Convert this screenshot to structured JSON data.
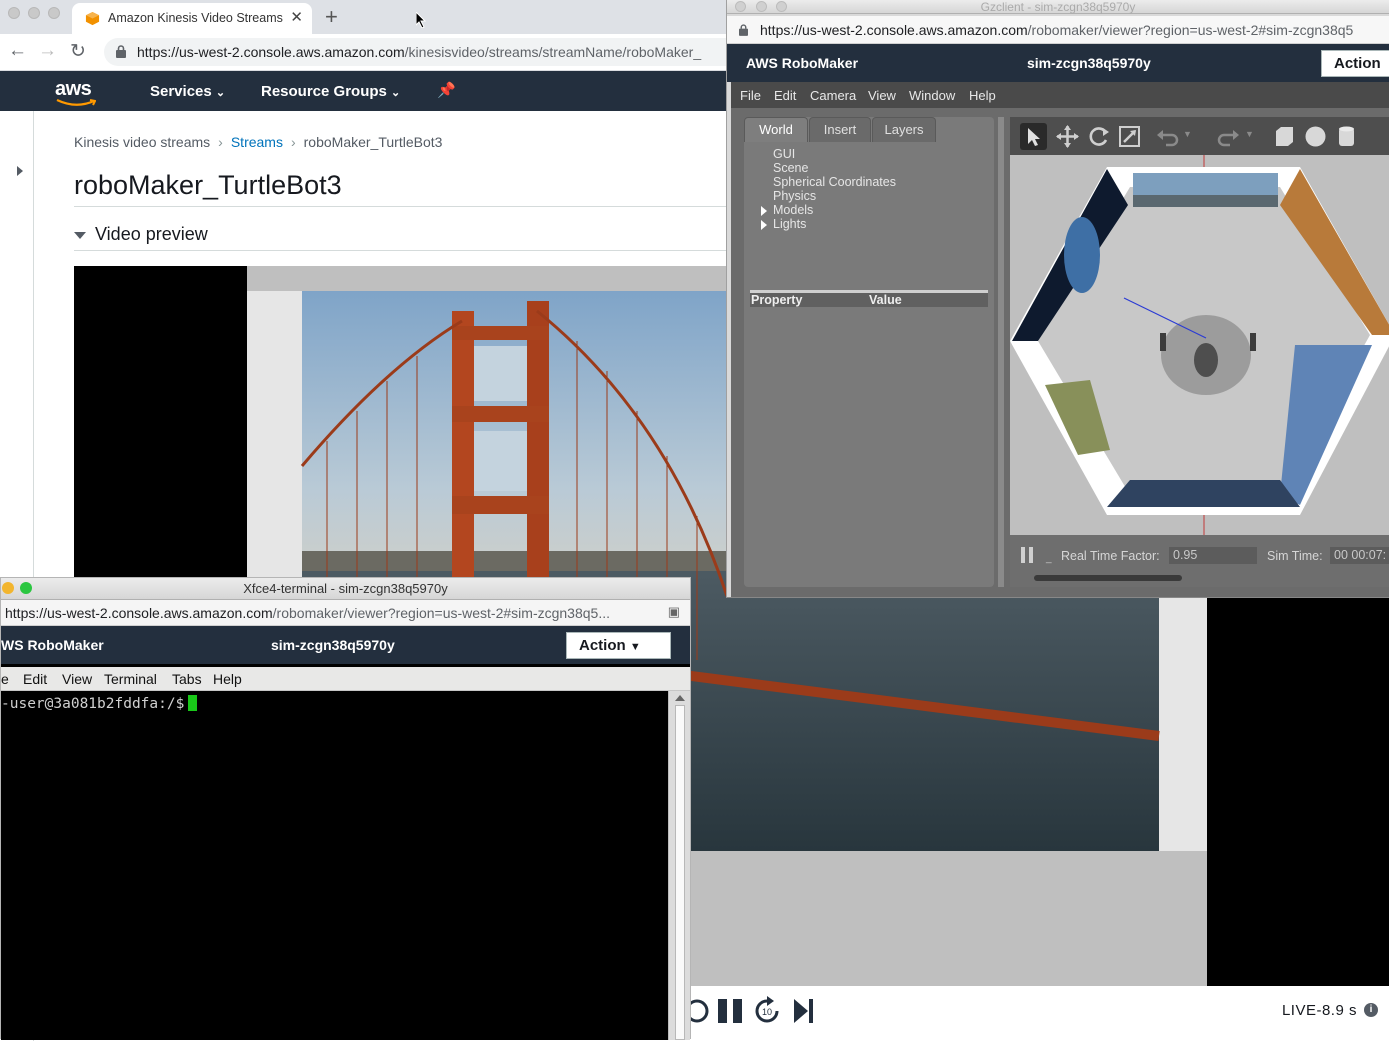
{
  "browser": {
    "tab_title": "Amazon Kinesis Video Streams",
    "url_host": "https://us-west-2.console.aws.amazon.com",
    "url_path": "/kinesisvideo/streams/streamName/roboMaker_"
  },
  "aws_nav": {
    "logo": "aws",
    "services": "Services",
    "resource_groups": "Resource Groups"
  },
  "breadcrumb": {
    "root": "Kinesis video streams",
    "streams": "Streams",
    "current": "roboMaker_TurtleBot3"
  },
  "page": {
    "title": "roboMaker_TurtleBot3",
    "section": "Video preview",
    "live": "LIVE-8.9 s",
    "info_icon": "i"
  },
  "terminal_window": {
    "title": "Xfce4-terminal - sim-zcgn38q5970y",
    "url_host": "https://us-west-2.console.aws.amazon.com",
    "url_path": "/robomaker/viewer?region=us-west-2#sim-zcgn38q5...",
    "brand": "WS RoboMaker",
    "sim_id": "sim-zcgn38q5970y",
    "action": "Action",
    "menu": [
      "e",
      "Edit",
      "View",
      "Terminal",
      "Tabs",
      "Help"
    ],
    "prompt": "-user@3a081b2fddfa:/$"
  },
  "gz_window": {
    "title": "Gzclient - sim-zcgn38q5970y",
    "url_host": "https://us-west-2.console.aws.amazon.com",
    "url_path": "/robomaker/viewer?region=us-west-2#sim-zcgn38q5",
    "brand": "AWS RoboMaker",
    "sim_id": "sim-zcgn38q5970y",
    "action": "Action",
    "menu": [
      "File",
      "Edit",
      "Camera",
      "View",
      "Window",
      "Help"
    ],
    "tabs": [
      "World",
      "Insert",
      "Layers"
    ],
    "tree": [
      "GUI",
      "Scene",
      "Spherical Coordinates",
      "Physics",
      "Models",
      "Lights"
    ],
    "prop_header": "Property",
    "value_header": "Value",
    "real_time_factor_label": "Real Time Factor:",
    "real_time_factor": "0.95",
    "sim_time_label": "Sim Time:",
    "sim_time": "00 00:07:"
  }
}
